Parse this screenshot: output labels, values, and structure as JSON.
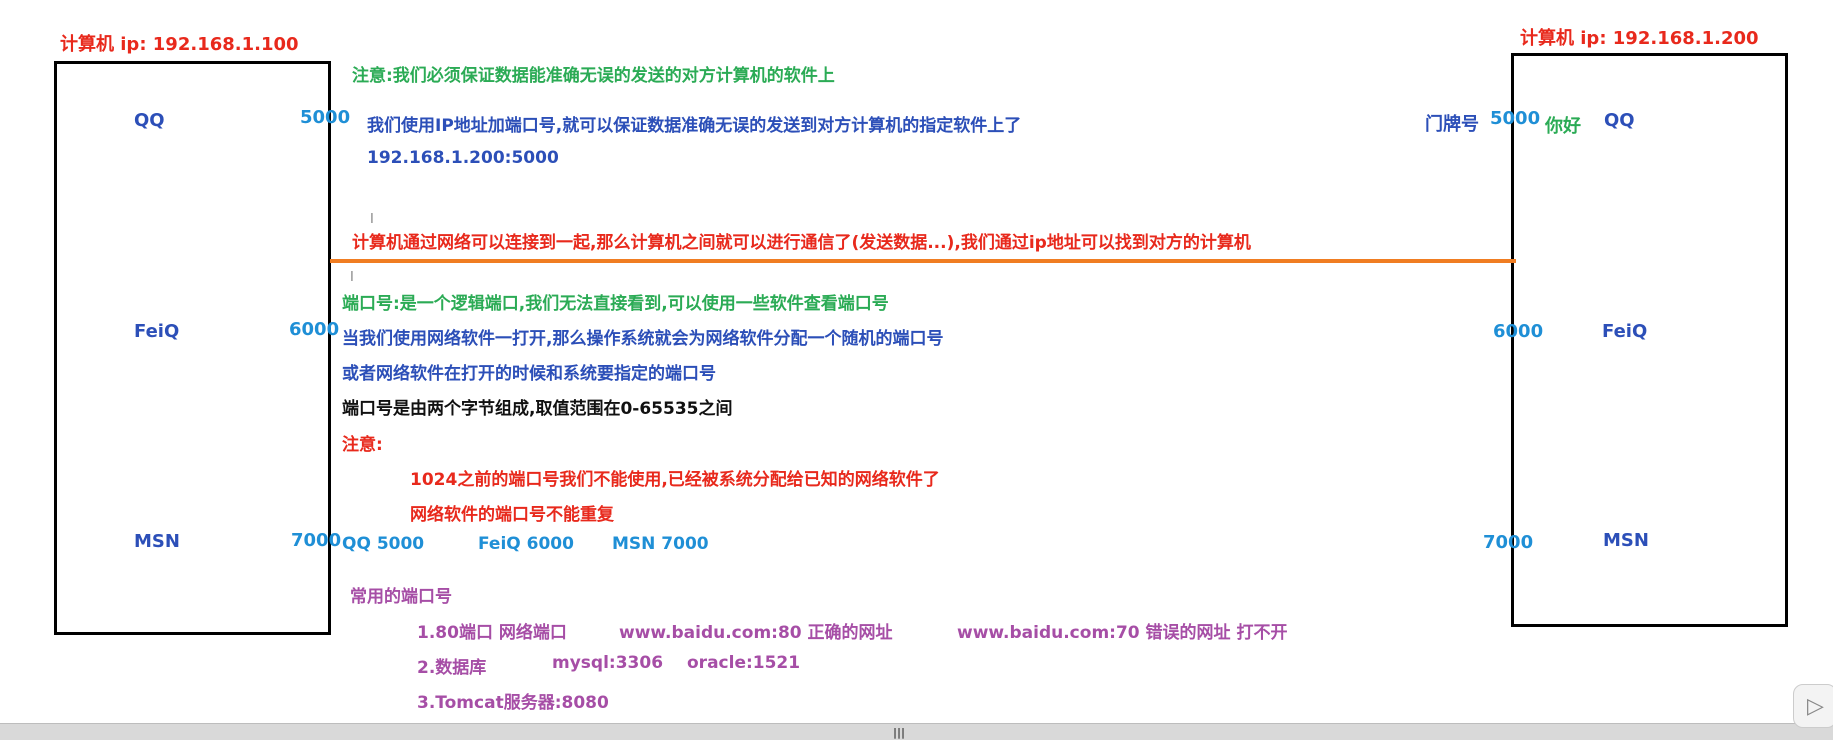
{
  "left_host": {
    "title": "计算机 ip: 192.168.1.100",
    "apps": [
      {
        "name": "QQ",
        "port": "5000"
      },
      {
        "name": "FeiQ",
        "port": "6000"
      },
      {
        "name": "MSN",
        "port": "7000"
      }
    ]
  },
  "right_host": {
    "title": "计算机 ip: 192.168.1.200",
    "door_label": "门牌号",
    "greeting": "你好",
    "apps": [
      {
        "name": "QQ",
        "port": "5000"
      },
      {
        "name": "FeiQ",
        "port": "6000"
      },
      {
        "name": "MSN",
        "port": "7000"
      }
    ]
  },
  "notes": {
    "note1": "注意:我们必须保证数据能准确无误的发送的对方计算机的软件上",
    "note2": "我们使用IP地址加端口号,就可以保证数据准确无误的发送到对方计算机的指定软件上了",
    "address": "192.168.1.200:5000",
    "network_line": "计算机通过网络可以连接到一起,那么计算机之间就可以进行通信了(发送数据...),我们通过ip地址可以找到对方的计算机",
    "port_def": "端口号:是一个逻辑端口,我们无法直接看到,可以使用一些软件查看端口号",
    "port_random": "当我们使用网络软件一打开,那么操作系统就会为网络软件分配一个随机的端口号",
    "port_specify": "或者网络软件在打开的时候和系统要指定的端口号",
    "port_range": "端口号是由两个字节组成,取值范围在0-65535之间",
    "attention": "注意:",
    "attention1": "1024之前的端口号我们不能使用,已经被系统分配给已知的网络软件了",
    "attention2": "网络软件的端口号不能重复",
    "qq_port": "QQ 5000",
    "feiq_port": "FeiQ 6000",
    "msn_port": "MSN 7000",
    "common_title": "常用的端口号",
    "common1_a": "1.80端口 网络端口",
    "common1_b": "www.baidu.com:80 正确的网址",
    "common1_c": "www.baidu.com:70 错误的网址 打不开",
    "common2_a": "2.数据库",
    "common2_b": "mysql:3306",
    "common2_c": "oracle:1521",
    "common3": "3.Tomcat服务器:8080"
  },
  "ui": {
    "grip": "|||",
    "play_icon": "▷"
  },
  "colors": {
    "red": "#e8291c",
    "blue": "#2c4fb8",
    "cyan": "#1f8fd6",
    "green": "#2bab55",
    "purple": "#a64ea6",
    "orange": "#f07d22"
  }
}
